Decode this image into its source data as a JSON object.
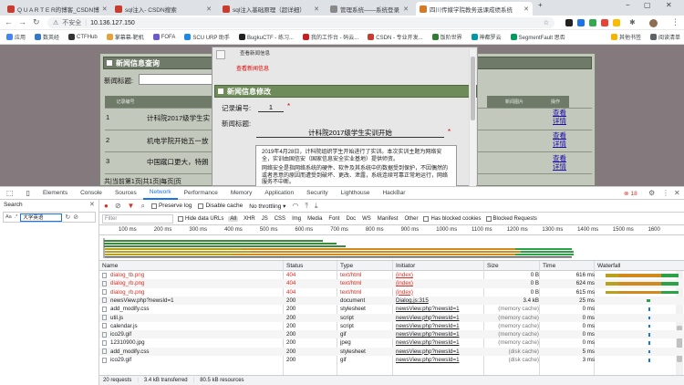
{
  "browser": {
    "tabs": [
      {
        "title": "Q U A R T E R的博客_CSDN博",
        "fav": "#c73c2e"
      },
      {
        "title": "sql注入- CSDN搜索",
        "fav": "#c73c2e"
      },
      {
        "title": "sql注入基础原理（超详细）",
        "fav": "#c73c2e"
      },
      {
        "title": "管理系统——系统登录",
        "fav": "#888888"
      },
      {
        "title": "四川传媒学院教务选课成绩系统",
        "fav": "#d47b2a"
      }
    ],
    "security_label": "不安全",
    "url": "10.136.127.150",
    "bookmarks": [
      {
        "label": "应用",
        "color": "#4285f4"
      },
      {
        "label": "数英经",
        "color": "#3478c8"
      },
      {
        "label": "CTFHub",
        "color": "#333333"
      },
      {
        "label": "掌幕幕-靶机",
        "color": "#e8a13a"
      },
      {
        "label": "FOFA",
        "color": "#6a5acd"
      },
      {
        "label": "SCU URP 助手",
        "color": "#1e88e5"
      },
      {
        "label": "BugkuCTF - 练习...",
        "color": "#222222"
      },
      {
        "label": "我的工作台 - 码云...",
        "color": "#c71d23"
      },
      {
        "label": "CSDN - 专业开发...",
        "color": "#c73c2e"
      },
      {
        "label": "饭阶世界",
        "color": "#2e7d32"
      },
      {
        "label": "神都罗云",
        "color": "#0097a7"
      },
      {
        "label": "SegmentFault 思否",
        "color": "#009a61"
      }
    ],
    "bookmarks_more": "其他书签",
    "reading_list": "阅读清单"
  },
  "page": {
    "main_title": "新闻信息查询",
    "search_label": "新闻标题:",
    "table_headers": [
      "记录编号",
      "新闻标题",
      "新闻图片",
      "操作"
    ],
    "rows": [
      {
        "id": "1",
        "title": "计科院2017级学生实",
        "action": "查看详情"
      },
      {
        "id": "2",
        "title": "机电学院开始五一放",
        "action": "查看详情"
      },
      {
        "id": "3",
        "title": "中国蹴口更大，特朗",
        "action": "查看详情"
      }
    ],
    "pager": "共|当前第1页|共1页|每页|页",
    "dialog": {
      "top_label": "查看新闻信息",
      "red_label": "查看新闻信息",
      "title": "新闻信息修改",
      "id_label": "记录编号:",
      "id_value": "1",
      "news_title_label": "新闻标题:",
      "news_title_value": "计科院2017级学生实训开始",
      "required_mark": "*",
      "content_p1": "2019年4月28日，计科院组织学生开始进行了实训。本次实训主题为网络安全，实训由国信安（国家信息安全实业基地）提供师资。",
      "content_p2": "网络安全是指网络系统的硬件、软件及其系统中的数据受到保护，不因偶然的或者恶意的原因而遭受到破坏、更改、泄露，系统连续可靠正常地运行，网络服务不中断。"
    }
  },
  "devtools": {
    "tabs": [
      "Elements",
      "Console",
      "Sources",
      "Network",
      "Performance",
      "Memory",
      "Application",
      "Security",
      "Lighthouse",
      "HackBar"
    ],
    "selected_tab": "Network",
    "error_count": "18",
    "search_label": "Search",
    "search_value": "大学英语",
    "toolbar": {
      "preserve_log": "Preserve log",
      "disable_cache": "Disable cache",
      "throttle": "No throttling"
    },
    "filter_placeholder": "Filter",
    "filters": {
      "hide_data_urls": "Hide data URLs",
      "types": [
        "All",
        "XHR",
        "JS",
        "CSS",
        "Img",
        "Media",
        "Font",
        "Doc",
        "WS",
        "Manifest",
        "Other"
      ],
      "blocked_cookies": "Has blocked cookies",
      "blocked_requests": "Blocked Requests"
    },
    "ticks": [
      "100 ms",
      "200 ms",
      "300 ms",
      "400 ms",
      "500 ms",
      "600 ms",
      "700 ms",
      "800 ms",
      "900 ms",
      "1000 ms",
      "1100 ms",
      "1200 ms",
      "1300 ms",
      "1400 ms",
      "1500 ms",
      "1600"
    ],
    "columns": [
      "Name",
      "Status",
      "Type",
      "Initiator",
      "Size",
      "Time",
      "Waterfall"
    ],
    "requests": [
      {
        "name": "dialog_tb.png",
        "status": "404",
        "type": "text/html",
        "initiator": "(index)",
        "size": "0 B",
        "time": "616 ms",
        "err": true
      },
      {
        "name": "dialog_rb.png",
        "status": "404",
        "type": "text/html",
        "initiator": "(index)",
        "size": "0 B",
        "time": "624 ms",
        "err": true
      },
      {
        "name": "dialog_rb.png",
        "status": "404",
        "type": "text/html",
        "initiator": "(index)",
        "size": "0 B",
        "time": "615 ms",
        "err": true
      },
      {
        "name": "newsView.php?newsId=1",
        "status": "200",
        "type": "document",
        "initiator": "Dialog.js:315",
        "size": "3.4 kB",
        "time": "25 ms",
        "err": false
      },
      {
        "name": "add_modify.css",
        "status": "200",
        "type": "stylesheet",
        "initiator": "newsView.php?newsId=1",
        "size": "(memory cache)",
        "time": "0 ms",
        "err": false
      },
      {
        "name": "util.js",
        "status": "200",
        "type": "script",
        "initiator": "newsView.php?newsId=1",
        "size": "(memory cache)",
        "time": "0 ms",
        "err": false
      },
      {
        "name": "calendar.js",
        "status": "200",
        "type": "script",
        "initiator": "newsView.php?newsId=1",
        "size": "(memory cache)",
        "time": "0 ms",
        "err": false
      },
      {
        "name": "ico29.gif",
        "status": "200",
        "type": "gif",
        "initiator": "newsView.php?newsId=1",
        "size": "(memory cache)",
        "time": "0 ms",
        "err": false
      },
      {
        "name": "12310900.jpg",
        "status": "200",
        "type": "jpeg",
        "initiator": "newsView.php?newsId=1",
        "size": "(memory cache)",
        "time": "0 ms",
        "err": false
      },
      {
        "name": "add_modify.css",
        "status": "200",
        "type": "stylesheet",
        "initiator": "newsView.php?newsId=1",
        "size": "(disk cache)",
        "time": "5 ms",
        "err": false
      },
      {
        "name": "ico29.gif",
        "status": "200",
        "type": "gif",
        "initiator": "newsView.php?newsId=1",
        "size": "(disk cache)",
        "time": "3 ms",
        "err": false
      }
    ],
    "status_bar": {
      "requests": "20 requests",
      "transferred": "3.4 kB transferred",
      "resources": "80.5 kB resources"
    }
  }
}
